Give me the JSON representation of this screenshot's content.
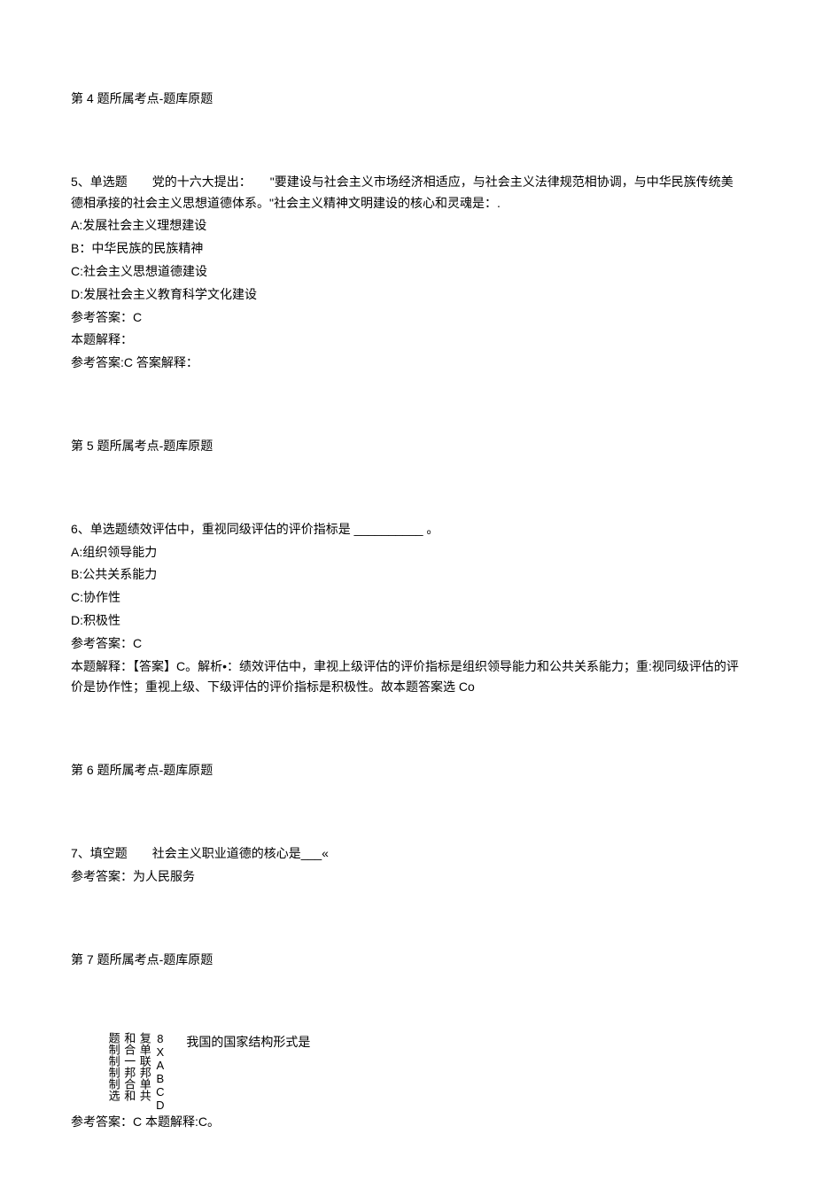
{
  "q4_ref": "第 4 题所属考点-题库原题",
  "q5": {
    "stem": "5、单选题　　党的十六大提出：　　\"要建设与社会主义市场经济相适应，与社会主义法律规范相协调，与中华民族传统美德相承接的社会主义思想道德体系。\"社会主义精神文明建设的核心和灵魂是：.",
    "optA": "A:发展社会主义理想建设",
    "optB": "B：中华民族的民族精神",
    "optC": "C:社会主义思想道德建设",
    "optD": "D:发展社会主义教育科学文化建设",
    "ansLabel": "参考答案：C",
    "expLabel": "本题解释：",
    "expText": "参考答案:C 答案解释："
  },
  "q5_ref": "第 5 题所属考点-题库原题",
  "q6": {
    "stem": "6、单选题绩效评估中，重视同级评估的评价指标是 __________ 。",
    "optA": "A:组织领导能力",
    "optB": "B:公共关系能力",
    "optC": "C:协作性",
    "optD": "D:积极性",
    "ansLabel": "参考答案：C",
    "expText": "本题解释：【答案】C。解析•：绩效评估中，聿视上级评估的评价指标是组织领导能力和公共关系能力；重:视同级评估的评价是协作性；重视上级、下级评估的评价指标是积极性。故本题答案选 Co"
  },
  "q6_ref": "第 6 题所属考点-题库原题",
  "q7": {
    "stem": "7、填空题　　社会主义职业道德的核心是___«",
    "ansLabel": "参考答案：为人民服务"
  },
  "q7_ref": "第 7 题所属考点-题库原题",
  "q8": {
    "vcol1": "8XABCD",
    "vcol2": "复单联邦单共",
    "vcol3": "和合一邦合和",
    "vcol4": "题制制制制选",
    "horiz": "我国的国家结构形式是",
    "ansLabel": "参考答案：C 本题解释:C。"
  }
}
